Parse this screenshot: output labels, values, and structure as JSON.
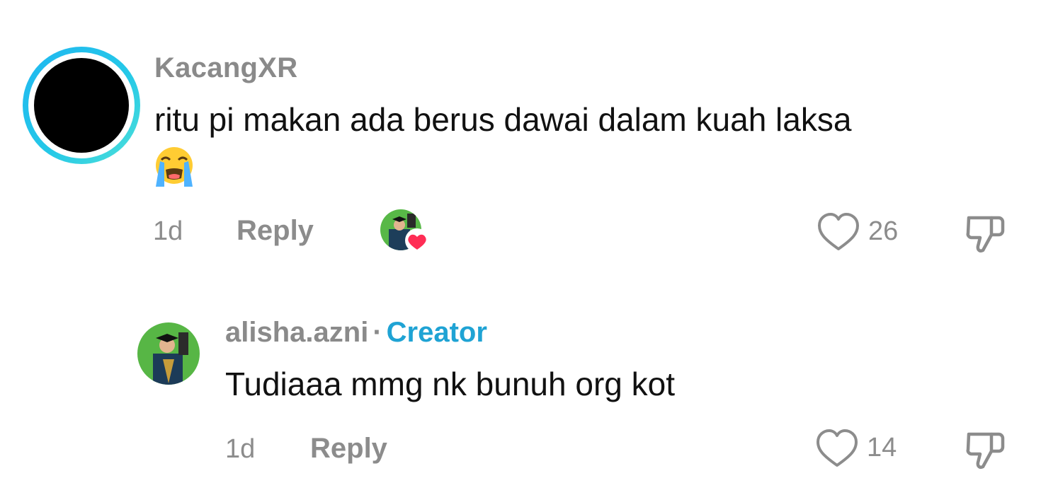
{
  "comment": {
    "username": "KacangXR",
    "text": "ritu pi makan ada berus dawai dalam kuah laksa",
    "emoji": "loudly-crying-face",
    "time": "1d",
    "reply_label": "Reply",
    "likes": "26",
    "liked_by_creator": true
  },
  "reply": {
    "username": "alisha.azni",
    "separator": "·",
    "badge": "Creator",
    "text": "Tudiaaa mmg nk bunuh org kot",
    "time": "1d",
    "reply_label": "Reply",
    "likes": "14"
  },
  "colors": {
    "creator_badge": "#1fa3d4",
    "muted_text": "#8c8c8c",
    "liked_heart": "#ff2d55",
    "avatar_ring": "#24c8e8"
  }
}
